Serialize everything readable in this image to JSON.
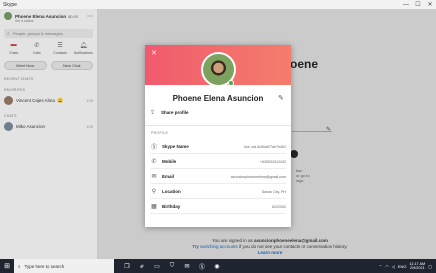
{
  "window": {
    "title": "Skype",
    "minimize": "—",
    "maximize": "☐",
    "close": "✕"
  },
  "sidebar": {
    "profile_name": "Phoene Elena Asuncion",
    "balance": "$0.00",
    "status": "Set a status",
    "search_placeholder": "People, groups & messages",
    "nav": [
      {
        "label": "Chats",
        "icon": "chat-icon"
      },
      {
        "label": "Calls",
        "icon": "phone-icon"
      },
      {
        "label": "Contacts",
        "icon": "contacts-icon"
      },
      {
        "label": "Notifications",
        "icon": "bell-icon"
      }
    ],
    "meet_now": "Meet Now",
    "new_chat": "New Chat",
    "recent_label": "RECENT CHATS",
    "favorites_label": "FAVORITES",
    "chats_label": "CHATS",
    "contacts": [
      {
        "name": "Vincent Cajes Alma",
        "time": "1/19",
        "emoji": "😀"
      },
      {
        "name": "Miko Asuncion",
        "time": "1/19",
        "emoji": ""
      }
    ]
  },
  "main": {
    "bg_name": "oene",
    "side_text": [
      "tion",
      "or go to",
      "ings"
    ],
    "signin_prefix": "You are signed in as",
    "signin_email": "asuncionphoeneelena@gmail.com",
    "signin_line2_a": "Try",
    "signin_switch": "switching accounts",
    "signin_line2_b": "if you do not see your contacts or conversation history.",
    "learn_more": "Learn more"
  },
  "modal": {
    "close": "✕",
    "name": "Phoene Elena Asuncion",
    "share_profile": "Share profile",
    "section": "PROFILE",
    "fields": [
      {
        "label": "Skype Name",
        "value": "live:.cid.5c50af27de7b4b1",
        "icon": "skype-icon"
      },
      {
        "label": "Mobile",
        "value": "+639534313432",
        "icon": "phone-icon"
      },
      {
        "label": "Email",
        "value": "asuncionphoeneelena@gmail.com",
        "icon": "mail-icon"
      },
      {
        "label": "Location",
        "value": "Davao City, PH",
        "icon": "location-icon"
      },
      {
        "label": "Birthday",
        "value": "6/2/2002",
        "icon": "calendar-icon"
      }
    ]
  },
  "taskbar": {
    "search_placeholder": "Type here to search",
    "time": "11:17 AM",
    "date": "2/9/2021",
    "lang": "ENG"
  },
  "colors": {
    "header_start": "#f15a6e",
    "header_end": "#f47d6b",
    "online": "#3fae49",
    "link": "#1a5fb4"
  }
}
